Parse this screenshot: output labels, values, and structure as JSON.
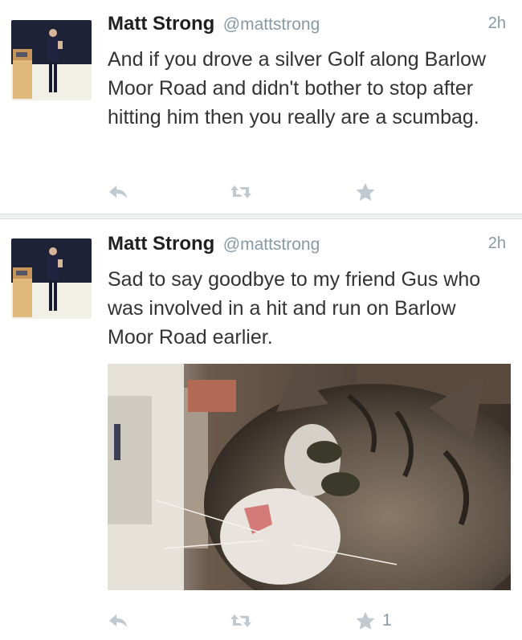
{
  "tweets": [
    {
      "user": {
        "name": "Matt Strong",
        "handle": "@mattstrong"
      },
      "time": "2h",
      "text": "And if you drove a silver Golf along Barlow Moor Road and didn't bother to stop after hitting him then you really are a scumbag.",
      "actions": {
        "reply_icon": "reply-icon",
        "retweet_icon": "retweet-icon",
        "favorite_icon": "star-icon",
        "favorite_count": ""
      }
    },
    {
      "user": {
        "name": "Matt Strong",
        "handle": "@mattstrong"
      },
      "time": "2h",
      "text": "Sad to say goodbye to my friend Gus who was involved in a hit and run on Barlow Moor Road earlier.",
      "media": "cat photo",
      "actions": {
        "reply_icon": "reply-icon",
        "retweet_icon": "retweet-icon",
        "favorite_icon": "star-icon",
        "favorite_count": "1"
      }
    }
  ],
  "colors": {
    "divider": "#eef0f2",
    "icon": "#c1c9d0",
    "muted": "#8899a6"
  }
}
